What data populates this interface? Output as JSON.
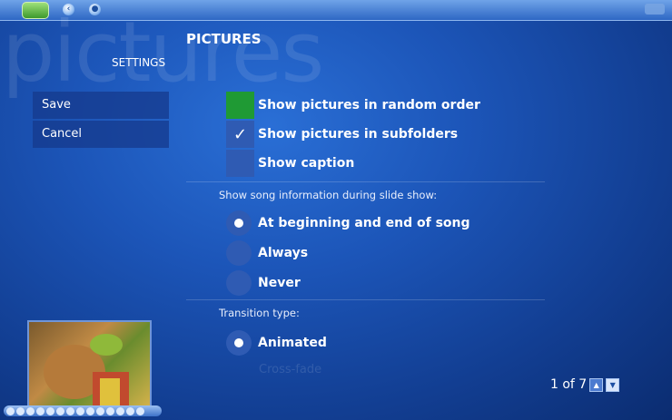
{
  "window": {
    "background_word": "pictures",
    "title": "PICTURES",
    "subtitle": "SETTINGS"
  },
  "actions": [
    {
      "label": "Save"
    },
    {
      "label": "Cancel"
    }
  ],
  "checkboxes": [
    {
      "label": "Show pictures in random order",
      "checked": false,
      "highlighted": true
    },
    {
      "label": "Show pictures in subfolders",
      "checked": true,
      "check_mark": "✓"
    },
    {
      "label": "Show caption",
      "checked": false
    }
  ],
  "song_info": {
    "heading": "Show song information during slide show:",
    "options": [
      {
        "label": "At beginning and end of song",
        "selected": true
      },
      {
        "label": "Always",
        "selected": false
      },
      {
        "label": "Never",
        "selected": false
      }
    ]
  },
  "transition": {
    "heading": "Transition type:",
    "options": [
      {
        "label": "Animated",
        "selected": true
      },
      {
        "label": "Cross-fade",
        "selected": false
      }
    ]
  },
  "pager": {
    "text": "1 of 7",
    "up_icon": "up-arrow-icon",
    "down_icon": "down-arrow-icon"
  },
  "colors": {
    "accent_green": "#1f9a34",
    "background": "#1c55b8"
  }
}
